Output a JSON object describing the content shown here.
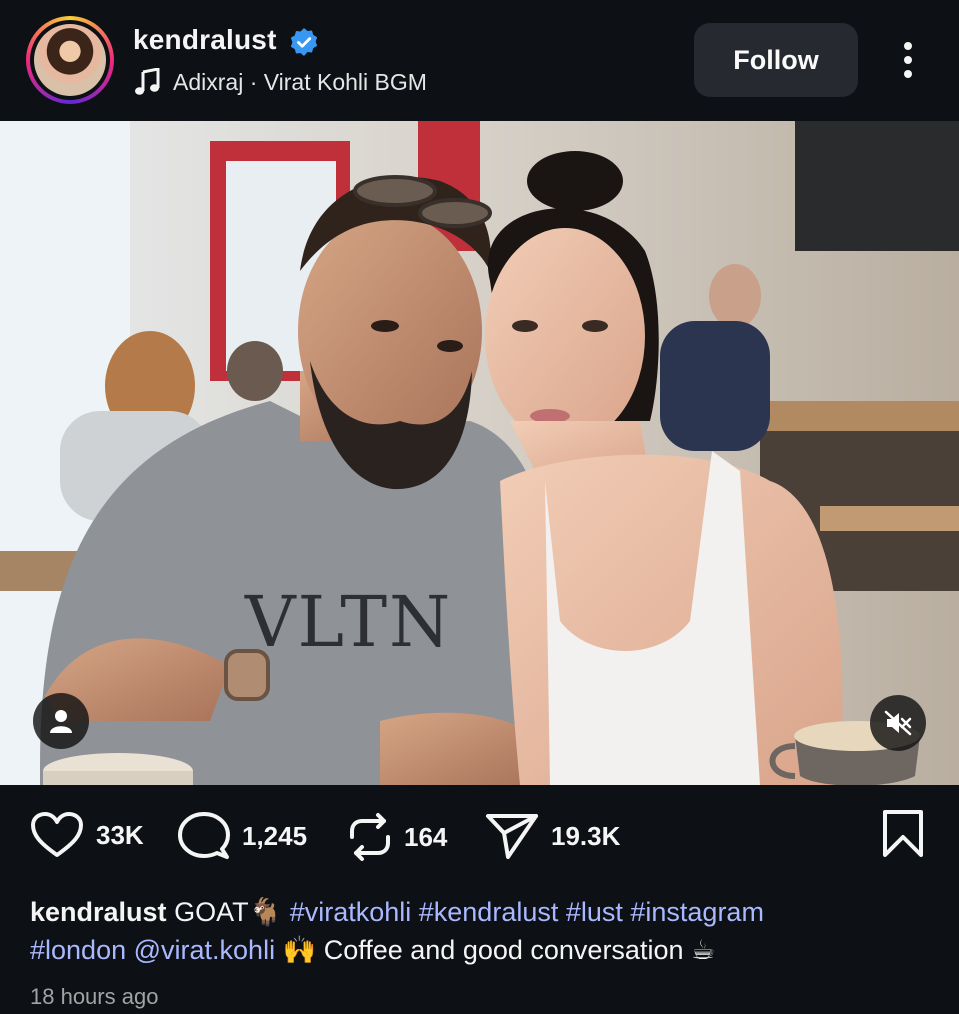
{
  "post": {
    "username": "kendralust",
    "audio": "Adixraj · Virat Kohli BGM",
    "follow_label": "Follow",
    "likes": "33K",
    "comments": "1,245",
    "reposts": "164",
    "shares": "19.3K",
    "caption": {
      "username": "kendralust",
      "text_start": "GOAT🐐",
      "hashtags_line1": "#viratkohli #kendralust #lust #instagram",
      "hashtag_line2": "#london",
      "mention": "@virat.kohli",
      "text_end": "🙌 Coffee and good conversation ☕"
    },
    "timestamp": "18 hours ago"
  },
  "photo": {
    "shirt_text": "VLTN"
  },
  "icons": {
    "verified": "verified-badge-icon",
    "music": "music-note-icon",
    "more": "more-options-icon",
    "like": "heart-icon",
    "comment": "comment-icon",
    "repost": "repost-icon",
    "share": "send-icon",
    "save": "bookmark-icon",
    "tag": "user-tag-icon",
    "mute": "muted-speaker-icon"
  },
  "colors": {
    "background": "#0d1014",
    "accent_link": "#a9b8ff",
    "verified": "#3897f0"
  }
}
